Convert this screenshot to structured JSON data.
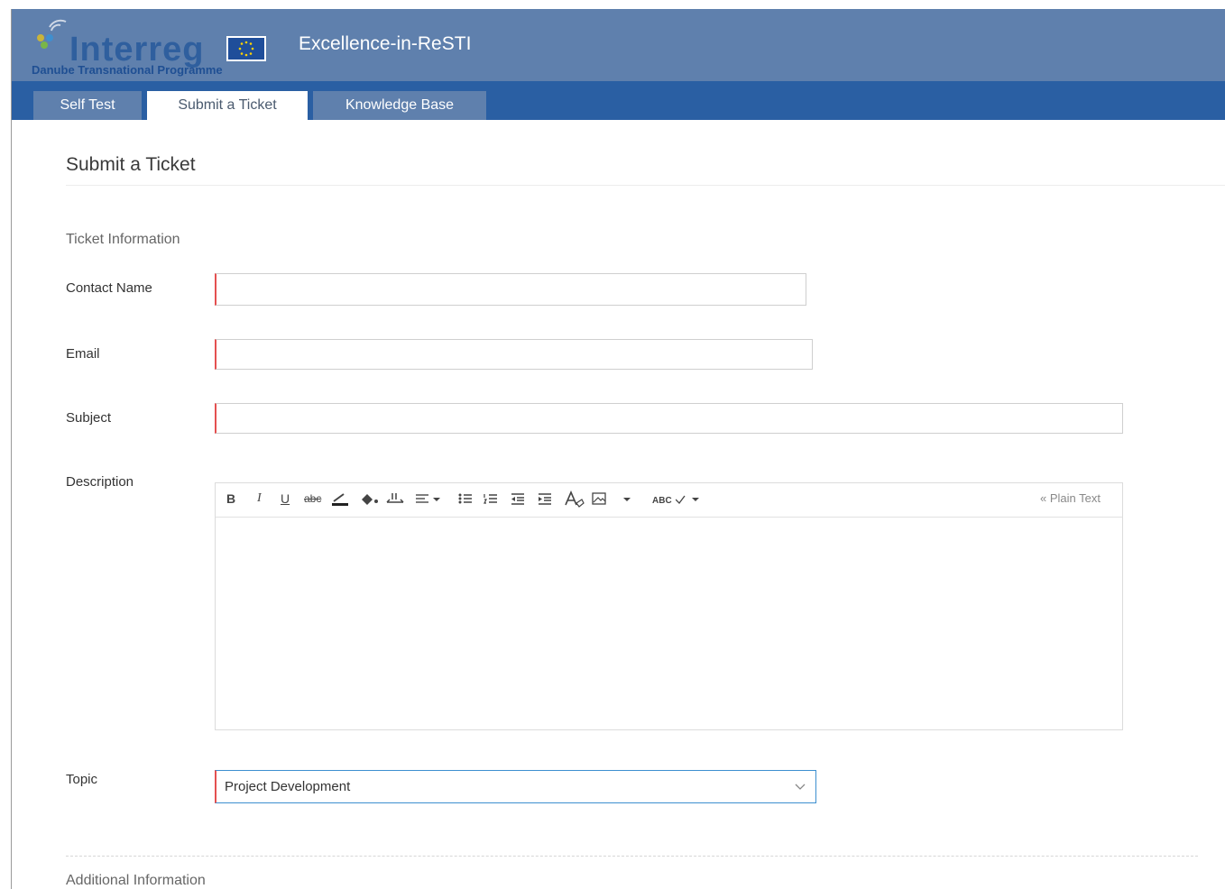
{
  "header": {
    "logo_word": "Interreg",
    "logo_subtitle": "Danube Transnational Programme",
    "app_title": "Excellence-in-ReSTI",
    "background_color": "#5f80ad"
  },
  "tabs": [
    {
      "label": "Self Test",
      "active": false
    },
    {
      "label": "Submit a Ticket",
      "active": true
    },
    {
      "label": "Knowledge Base",
      "active": false
    }
  ],
  "page": {
    "title": "Submit a Ticket",
    "section_ticket_info": "Ticket Information",
    "section_additional": "Additional Information"
  },
  "form": {
    "contact_name": {
      "label": "Contact Name",
      "value": ""
    },
    "email": {
      "label": "Email",
      "value": ""
    },
    "subject": {
      "label": "Subject",
      "value": ""
    },
    "description": {
      "label": "Description",
      "toolbar_icons": [
        "bold-icon",
        "italic-icon",
        "underline-icon",
        "strikethrough-icon",
        "font-color-icon",
        "fill-color-icon",
        "text-direction-icon",
        "align-icon",
        "bullet-list-icon",
        "numbered-list-icon",
        "outdent-icon",
        "indent-icon",
        "clear-format-icon",
        "insert-image-icon",
        "more-dropdown-icon",
        "spellcheck-icon"
      ],
      "bold_label": "B",
      "italic_label": "I",
      "underline_label": "U",
      "strike_label": "abc",
      "spellcheck_label": "ABC",
      "plain_text_link": "« Plain Text"
    },
    "topic": {
      "label": "Topic",
      "value": "Project Development"
    }
  },
  "colors": {
    "tab_bar": "#2a5fa3",
    "required_marker": "#e45050",
    "focus_border": "#3d8fd0"
  }
}
